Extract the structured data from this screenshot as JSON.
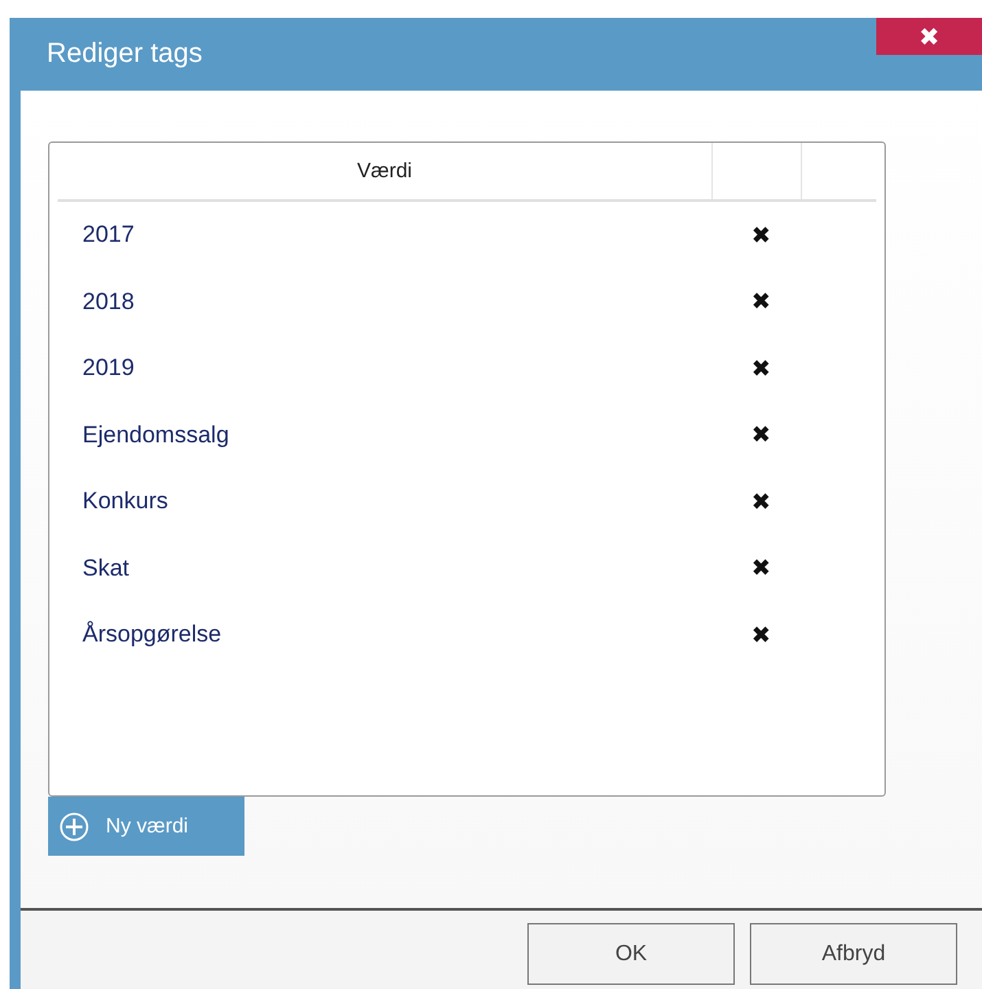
{
  "window": {
    "title": "Rediger tags",
    "close": "✖"
  },
  "table": {
    "columns": [
      "Værdi"
    ],
    "rows": [
      {
        "value": "2017",
        "delete": "✖"
      },
      {
        "value": "2018",
        "delete": "✖"
      },
      {
        "value": "2019",
        "delete": "✖"
      },
      {
        "value": "Ejendomssalg",
        "delete": "✖"
      },
      {
        "value": "Konkurs",
        "delete": "✖"
      },
      {
        "value": "Skat",
        "delete": "✖"
      },
      {
        "value": "Årsopgørelse",
        "delete": "✖"
      }
    ]
  },
  "add_button": "Ny værdi",
  "buttons": [
    "OK",
    "Afbryd"
  ]
}
